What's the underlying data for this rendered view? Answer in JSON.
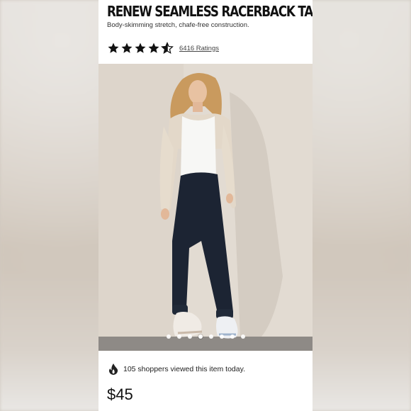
{
  "product": {
    "title": "RENEW SEAMLESS RACERBACK TANK",
    "subtitle": "Body-skimming stretch, chafe-free construction.",
    "rating": {
      "stars": 4.5,
      "max": 5,
      "ratings_label": "6416 Ratings"
    },
    "image": {
      "alt": "Model wearing white racerback tank, beige cardigan, navy joggers and white sneakers",
      "carousel_dots": 8,
      "active_dot": 3
    },
    "viewed_text": "105 shoppers viewed this item today.",
    "price": "$45"
  },
  "colors": {
    "star": "#111111",
    "text": "#111111",
    "pants": "#1c2433",
    "cardigan": "#e3d8c9"
  },
  "icons": {
    "star": "star-icon",
    "flame": "flame-icon"
  }
}
